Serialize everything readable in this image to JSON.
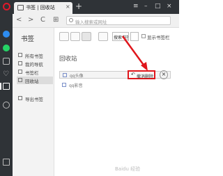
{
  "browser": {
    "tab_title": "书签 | 回收站",
    "new_tab_symbol": "+",
    "window_controls": [
      "≡",
      "–",
      "□",
      "×"
    ],
    "nav": {
      "back": "<",
      "forward": ">",
      "reload": "C"
    },
    "address_placeholder": "输入搜索或网址"
  },
  "bookmarks_panel": {
    "heading": "书签",
    "items": [
      {
        "label": "所有书签",
        "icon": "all-bookmarks-icon"
      },
      {
        "label": "我的导航",
        "icon": "speed-dial-icon"
      },
      {
        "label": "书签栏",
        "icon": "bookmark-bar-icon"
      },
      {
        "label": "回收站",
        "icon": "trash-icon",
        "active": true
      },
      {
        "label": "导出书签",
        "icon": "export-icon"
      }
    ]
  },
  "toolbar": {
    "search_label": "搜索书签",
    "show_bookmark_bar_label": "显示书签栏"
  },
  "main": {
    "section_title": "回收站",
    "items": [
      {
        "label": "qq头像"
      },
      {
        "label": "qq影音"
      }
    ],
    "undo_label": "撤消删除",
    "remove_symbol": "×"
  },
  "colors": {
    "highlight": "#e0161c",
    "sidebar_bg": "#2f3337",
    "opera_red": "#e0192a"
  },
  "watermark": "Baidu 经验"
}
